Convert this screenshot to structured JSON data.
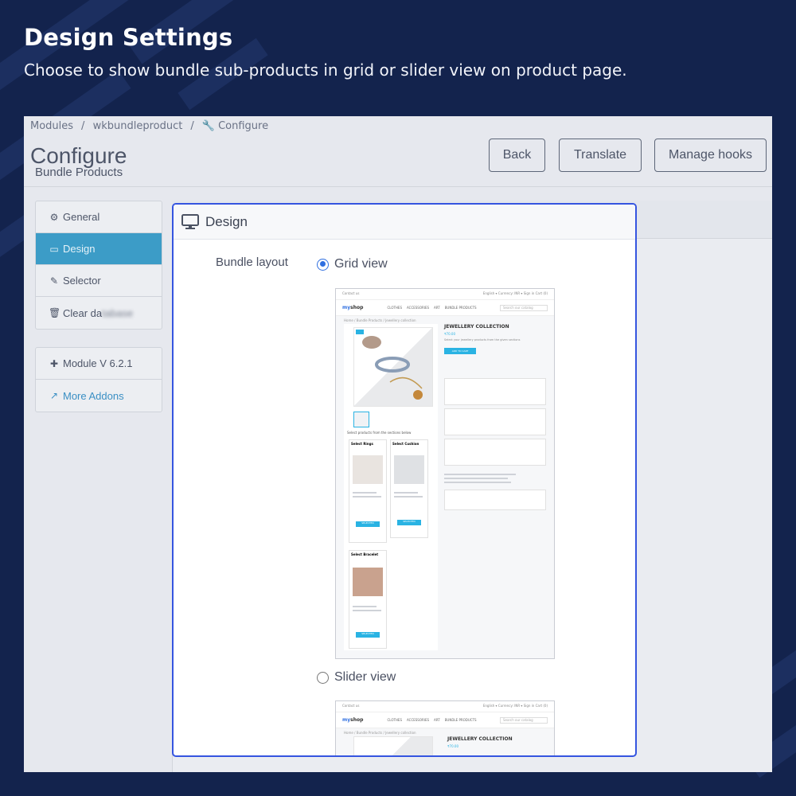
{
  "header": {
    "title": "Design Settings",
    "subtitle": "Choose to show bundle sub-products in grid or slider view on product page."
  },
  "breadcrumb": [
    "Modules",
    "wkbundleproduct",
    "Configure"
  ],
  "page": {
    "title": "Configure",
    "subtitle": "Bundle Products"
  },
  "toolbar": {
    "back": "Back",
    "translate": "Translate",
    "manage_hooks": "Manage hooks"
  },
  "sidebar": {
    "menu": [
      {
        "label": "General",
        "icon": "gear-icon"
      },
      {
        "label": "Design",
        "icon": "monitor-icon",
        "active": true
      },
      {
        "label": "Selector",
        "icon": "edit-icon"
      },
      {
        "label": "Clear da",
        "icon": "trash-icon"
      }
    ],
    "module_version": "Module V 6.2.1",
    "more_addons": "More Addons"
  },
  "panel": {
    "title": "Design",
    "field_label": "Bundle layout",
    "options": [
      {
        "label": "Grid view",
        "checked": true
      },
      {
        "label": "Slider view",
        "checked": false
      }
    ]
  },
  "preview": {
    "topbar_left": "Contact us",
    "topbar_right": "English ▾  Currency: INR ▾  Sign in  Cart (0)",
    "logo_a": "my",
    "logo_b": "shop",
    "menu": [
      "CLOTHES",
      "ACCESSORIES",
      "ART",
      "BUNDLE PRODUCTS"
    ],
    "search_placeholder": "Search our catalog",
    "crumb": "Home / Bundle Products / Jewellery collection",
    "product_name": "JEWELLERY COLLECTION",
    "price": "₹70.00",
    "description": "Select your jewellery products from the given sections",
    "add_to_cart": "ADD TO CART",
    "select_label": "Select products from the sections below",
    "sections": [
      "Select Rings",
      "Select Cushion",
      "Select Bracelet"
    ],
    "select_btn": "SELECTED"
  },
  "colors": {
    "background": "#13234d",
    "accent": "#3555e0",
    "active_tab": "#3c9cc7",
    "radio": "#2f6fe0"
  }
}
